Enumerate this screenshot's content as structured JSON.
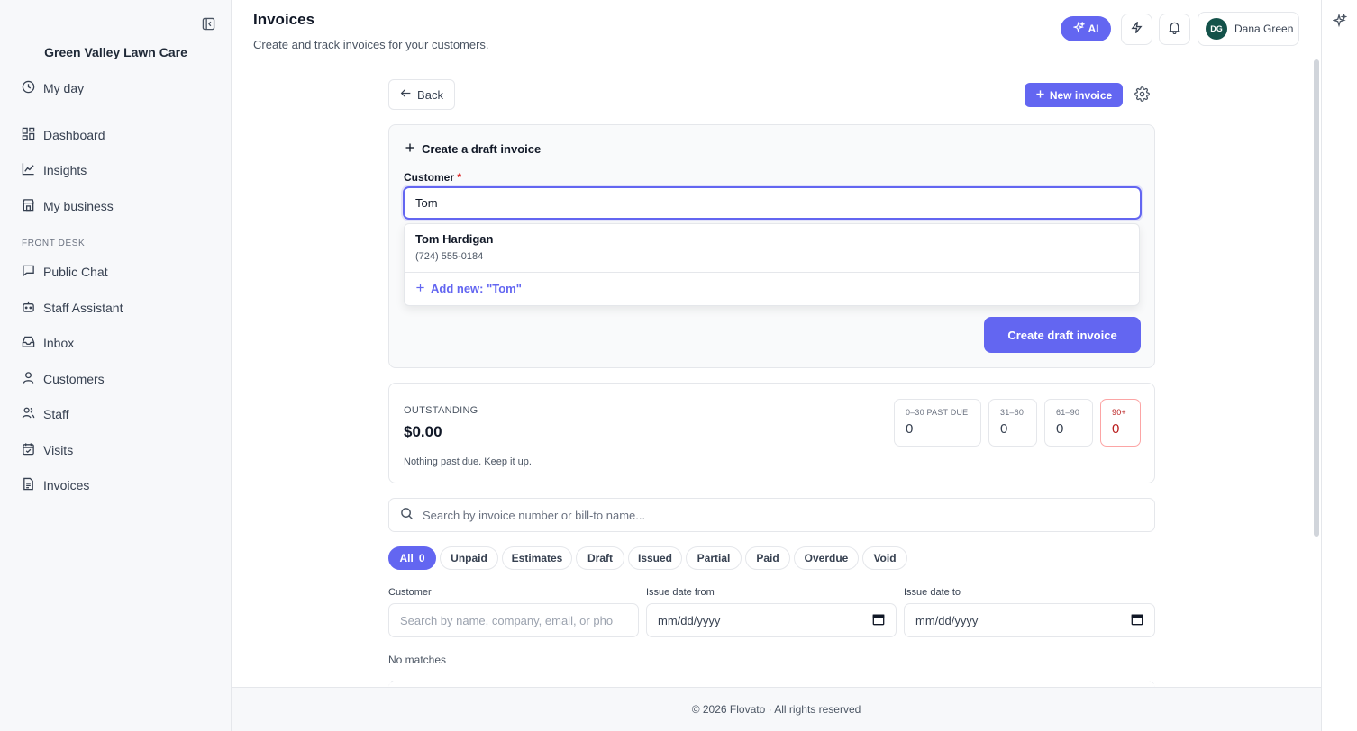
{
  "sidebar": {
    "brand": "Green Valley Lawn Care",
    "top_items": [
      {
        "label": "My day",
        "icon": "clock-icon"
      }
    ],
    "main_items": [
      {
        "label": "Dashboard",
        "icon": "dashboard-icon"
      },
      {
        "label": "Insights",
        "icon": "chart-line-icon"
      },
      {
        "label": "My business",
        "icon": "store-icon"
      }
    ],
    "section_title": "FRONT DESK",
    "front_desk_items": [
      {
        "label": "Public Chat",
        "icon": "chat-icon"
      },
      {
        "label": "Staff Assistant",
        "icon": "robot-icon"
      },
      {
        "label": "Inbox",
        "icon": "inbox-icon"
      },
      {
        "label": "Customers",
        "icon": "user-icon"
      },
      {
        "label": "Staff",
        "icon": "users-icon"
      },
      {
        "label": "Visits",
        "icon": "calendar-check-icon"
      },
      {
        "label": "Invoices",
        "icon": "document-icon"
      }
    ]
  },
  "header": {
    "title": "Invoices",
    "subtitle": "Create and track invoices for your customers.",
    "ai_label": "AI",
    "user_initials": "DG",
    "user_name": "Dana Green"
  },
  "toolbar": {
    "back_label": "Back",
    "new_invoice_label": "New invoice"
  },
  "draft": {
    "heading": "Create a draft invoice",
    "customer_label": "Customer",
    "required_mark": "*",
    "customer_value": "Tom",
    "suggestion_name": "Tom Hardigan",
    "suggestion_phone": "(724) 555-0184",
    "add_new_label": "Add new: \"Tom\"",
    "create_label": "Create draft invoice"
  },
  "outstanding": {
    "label": "OUTSTANDING",
    "amount": "$0.00",
    "note": "Nothing past due. Keep it up.",
    "aging": [
      {
        "label": "0–30 PAST DUE",
        "value": "0"
      },
      {
        "label": "31–60",
        "value": "0"
      },
      {
        "label": "61–90",
        "value": "0"
      },
      {
        "label": "90+",
        "value": "0"
      }
    ],
    "danger_color": "#b91c1c"
  },
  "search": {
    "placeholder": "Search by invoice number or bill-to name..."
  },
  "filters": {
    "chips": [
      "All",
      "Unpaid",
      "Estimates",
      "Draft",
      "Issued",
      "Partial",
      "Paid",
      "Overdue",
      "Void"
    ],
    "all_count": "0",
    "customer_label": "Customer",
    "customer_placeholder": "Search by name, company, email, or pho",
    "issue_from_label": "Issue date from",
    "issue_from_value": "mm/dd/yyyy",
    "issue_to_label": "Issue date to",
    "issue_to_value": "mm/dd/yyyy"
  },
  "results": {
    "empty_text": "No matches"
  },
  "footer": {
    "text": "© 2026 Flovato · All rights reserved"
  },
  "colors": {
    "accent": "#6366f1",
    "sidebar_bg": "#f7f8fa",
    "avatar_bg": "#14524a"
  }
}
